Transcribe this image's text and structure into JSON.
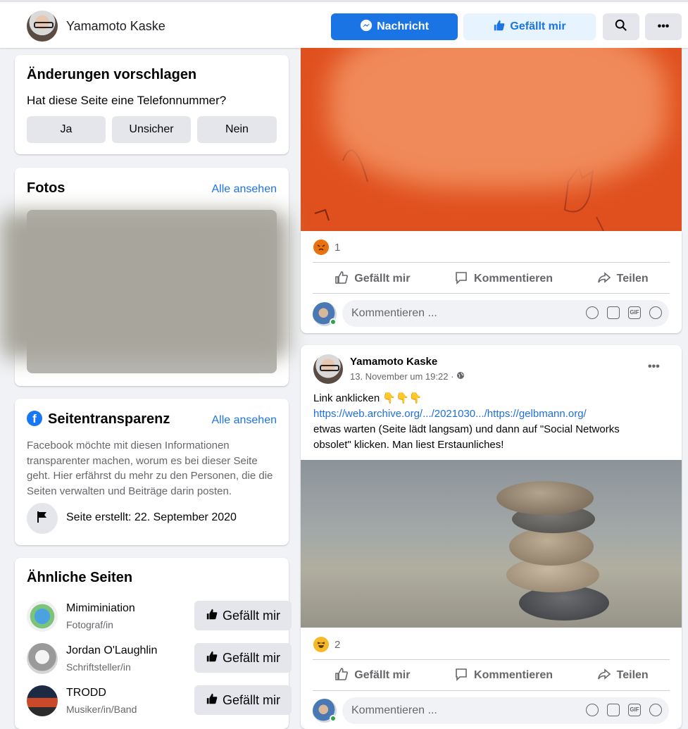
{
  "header": {
    "page_name": "Yamamoto Kaske",
    "message_label": "Nachricht",
    "like_label": "Gefällt mir",
    "more_label": "•••"
  },
  "suggest": {
    "title": "Änderungen vorschlagen",
    "question": "Hat diese Seite eine Telefonnummer?",
    "options": [
      "Ja",
      "Unsicher",
      "Nein"
    ]
  },
  "photos": {
    "title": "Fotos",
    "see_all": "Alle ansehen"
  },
  "transparency": {
    "title": "Seitentransparenz",
    "see_all": "Alle ansehen",
    "description": "Facebook möchte mit diesen Informationen transparenter machen, worum es bei dieser Seite geht. Hier erfährst du mehr zu den Personen, die die Seiten verwalten und Beiträge darin posten.",
    "created": "Seite erstellt: 22. September 2020"
  },
  "similar": {
    "title": "Ähnliche Seiten",
    "like_label": "Gefällt mir",
    "pages": [
      {
        "name": "Mimiminiation",
        "category": "Fotograf/in"
      },
      {
        "name": "Jordan O'Laughlin",
        "category": "Schriftsteller/in"
      },
      {
        "name": "TRODD",
        "category": "Musiker/in/Band"
      }
    ]
  },
  "post1": {
    "reaction_count": "1",
    "actions": [
      "Gefällt mir",
      "Kommentieren",
      "Teilen"
    ],
    "comment_placeholder": "Kommentieren ..."
  },
  "post2": {
    "author": "Yamamoto Kaske",
    "timestamp": "13. November um 19:22 ·",
    "line1": "Link anklicken 👇👇👇",
    "link": "https://web.archive.org/.../2021030.../https://gelbmann.org/",
    "line3": "etwas warten (Seite lädt langsam) und dann auf \"Social Networks",
    "line4": "obsolet\" klicken. Man liest Erstaunliches!",
    "reaction_count": "2",
    "actions": [
      "Gefällt mir",
      "Kommentieren",
      "Teilen"
    ],
    "comment_placeholder": "Kommentieren ...",
    "more_label": "•••"
  },
  "colors": {
    "accent": "#1b74e4",
    "orange_image": "#e0501e",
    "background": "#f0f2f5"
  }
}
